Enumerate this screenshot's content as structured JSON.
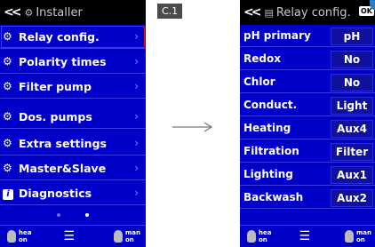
{
  "tag_label": "C.1",
  "left": {
    "title": "Installer",
    "menu": [
      {
        "label": "Relay config.",
        "icon": "gears-icon"
      },
      {
        "label": "Polarity times",
        "icon": "gears-icon"
      },
      {
        "label": "Filter pump",
        "icon": "gears-icon"
      },
      {
        "label": "Dos. pumps",
        "icon": "gears-icon"
      },
      {
        "label": "Extra settings",
        "icon": "gears-icon"
      },
      {
        "label": "Master&Slave",
        "icon": "gears-icon"
      },
      {
        "label": "Diagnostics",
        "icon": "info-icon"
      }
    ],
    "footer": {
      "left": "hea\non",
      "right": "man\non"
    }
  },
  "right": {
    "title": "Relay config.",
    "ok": "OK",
    "rows": [
      {
        "label": "pH primary",
        "value": "pH"
      },
      {
        "label": "Redox",
        "value": "No"
      },
      {
        "label": "Chlor",
        "value": "No"
      },
      {
        "label": "Conduct.",
        "value": "Light"
      },
      {
        "label": "Heating",
        "value": "Aux4"
      },
      {
        "label": "Filtration",
        "value": "Filter"
      },
      {
        "label": "Lighting",
        "value": "Aux1"
      },
      {
        "label": "Backwash",
        "value": "Aux2"
      }
    ],
    "footer": {
      "left": "hea\non",
      "right": "man\non"
    }
  }
}
